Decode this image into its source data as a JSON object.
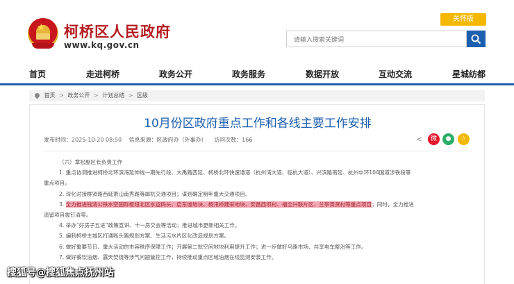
{
  "header": {
    "site_title": "柯桥区人民政府",
    "site_url": "www.kq.gov.cn",
    "care_label": "关怀版",
    "search_placeholder": "请输入搜索关键词"
  },
  "nav": {
    "items": [
      {
        "label": "首页"
      },
      {
        "label": "走进柯桥"
      },
      {
        "label": "政务公开"
      },
      {
        "label": "政务服务"
      },
      {
        "label": "数据开放"
      },
      {
        "label": "互动交流"
      },
      {
        "label": "星城纺都"
      }
    ]
  },
  "breadcrumb": {
    "items": [
      "首页",
      "政务公开",
      "计划总结",
      "区级"
    ],
    "separator": ">"
  },
  "article": {
    "title": "10月份区政府重点工作和各线主要工作安排",
    "published": "发布时间：2025-10-20 08:50",
    "source": "信息来源：区政府办（外事办）",
    "views": "访问次数：166",
    "paragraphs": [
      {
        "text": "（六）章松副区长负责工作"
      },
      {
        "text": "1. 重点协调推进柯桥北环滨海延伸线一期先行段、大禹路西延、柯桥北环快速通道（杭州湾大道、临杭大道）、兴滨路南延、杭州中环104国道涉铁段等"
      },
      {
        "text": "重点项目。"
      },
      {
        "text": "2. 深化对接群贤路西延萧山南秀路等邮杭交通项目；谋划确定明年重大交通项目。"
      },
      {
        "text": "3. ",
        "highlight": "全力推进钱清公铁水空国际枢纽北区水运码头、启东墟地块、杨汛桥建采地块、安昌西坝村、福全兴联片区、兰亭黄贤村等重点项目",
        "after": "；同时，全力推进"
      },
      {
        "text": "遗留项目拔钉清零。"
      },
      {
        "text": "4. 举办“好房子五进”政策宣讲、十一房交会等活动；推进城市更新相关工作。"
      },
      {
        "text": "5. 编制柯桥主城区打通断头路规划方案、生活污水片区化改造规划方案。"
      },
      {
        "text": "6. 做好重要节日、重大活动的市容秩序保障工作；开展第二批空闲地块利用提升工作；进一步做好马路市场、共享电车整治等工作。"
      },
      {
        "text": "7. 做好餐饮油烟、露天焚烧等涉气问题管控工作，持续推动重点区域油烟在线监测安装工作。"
      }
    ]
  },
  "watermark": "搜狐号@搜狐焦点抚州站",
  "colors": {
    "brand_red": "#b51a1f",
    "nav_blue": "#1b5fb0",
    "title_blue": "#1b5fb0",
    "care_yellow": "#f5b800",
    "highlight_pink": "#f2a6b2"
  },
  "icons": {
    "search": "search-icon",
    "emblem": "national-emblem-icon",
    "share": "share-icon",
    "weibo": "weibo-icon",
    "wechat": "wechat-icon",
    "favorite": "favorite-icon",
    "location": "location-icon"
  }
}
